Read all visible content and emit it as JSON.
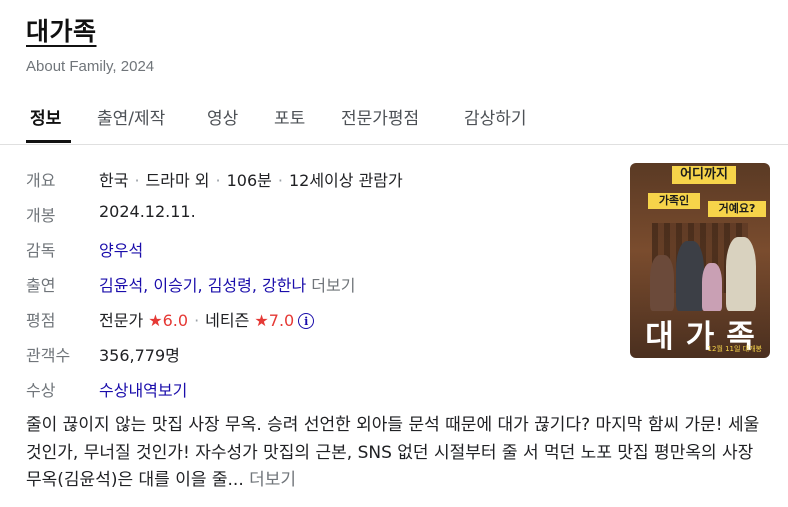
{
  "header": {
    "title": "대가족",
    "subtitle": "About Family, 2024"
  },
  "tabs": [
    {
      "label": "정보",
      "active": true
    },
    {
      "label": "출연/제작",
      "active": false
    },
    {
      "label": "영상",
      "active": false
    },
    {
      "label": "포토",
      "active": false
    },
    {
      "label": "전문가평점",
      "active": false
    },
    {
      "label": "감상하기",
      "active": false
    }
  ],
  "info": {
    "overview": {
      "label": "개요",
      "country": "한국",
      "genre": "드라마 외",
      "runtime": "106분",
      "rating": "12세이상 관람가"
    },
    "release": {
      "label": "개봉",
      "value": "2024.12.11."
    },
    "director": {
      "label": "감독",
      "value": "양우석"
    },
    "cast": {
      "label": "출연",
      "names": [
        "김윤석",
        "이승기",
        "김성령",
        "강한나"
      ],
      "more": "더보기"
    },
    "score": {
      "label": "평점",
      "critic_label": "전문가",
      "critic_value": "6.0",
      "netizen_label": "네티즌",
      "netizen_value": "7.0",
      "star_glyph": "★",
      "info_glyph": "i"
    },
    "audience": {
      "label": "관객수",
      "value": "356,779명"
    },
    "awards": {
      "label": "수상",
      "link": "수상내역보기"
    }
  },
  "poster": {
    "top_text": "어디까지",
    "mid_text_1": "가족인",
    "mid_text_2": "거예요?",
    "title_text": "대가족",
    "foot_text": "12월 11일 대개봉"
  },
  "description": {
    "text": "줄이 끊이지 않는 맛집 사장 무옥. 승려 선언한 외아들 문석 때문에 대가 끊기다? 마지막 함씨 가문! 세울 것인가, 무너질 것인가! 자수성가 맛집의 근본, SNS 없던 시절부터 줄 서 먹던 노포 맛집 평만옥의 사장 무옥(김윤석)은 대를 이을 줄...",
    "more": "더보기"
  },
  "colors": {
    "link": "#1a0dab",
    "star": "#e53935",
    "muted": "#70757a",
    "poster_accent": "#f6d44a"
  }
}
